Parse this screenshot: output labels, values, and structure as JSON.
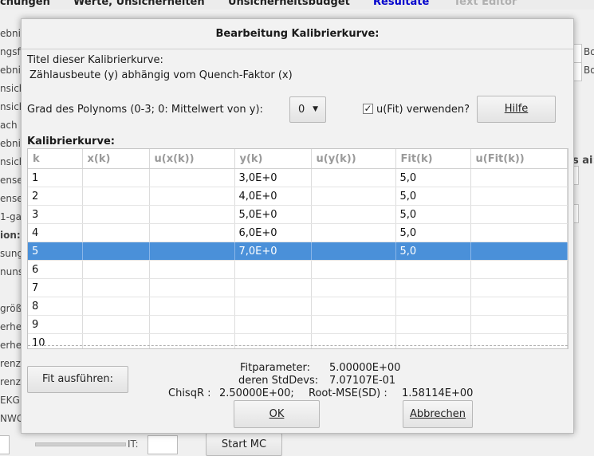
{
  "background": {
    "tabs": [
      "chungen",
      "Werte, Unsicherheiten",
      "Unsicherheitsbudget",
      "Resultate",
      "Text Editor"
    ],
    "tab_colors": {
      "active": "#0000cc",
      "disabled": "#b0b0b0"
    },
    "left_items": [
      "ebnis",
      "ngsfä",
      "ebnis",
      "nsich",
      "nsich",
      "ach",
      "ebnis",
      "nsich",
      "ense",
      "ense",
      "1-ga",
      "ion:",
      "sung",
      "nuns:",
      "",
      "größe",
      "erhei",
      "erhei",
      "renze",
      "renze",
      "EKG",
      "NWG"
    ],
    "right_labels": [
      "Bo",
      "Bo",
      "s ai:"
    ],
    "it_label": "IT:",
    "start_mc_label": "Start MC"
  },
  "dialog": {
    "title": "Bearbeitung Kalibrierkurve:",
    "curve_title_label": "Titel dieser Kalibrierkurve:",
    "curve_title_value": "Zählausbeute (y) abhängig vom Quench-Faktor (x)",
    "polynom_label": "Grad des Polynoms (0-3; 0: Mittelwert von y):",
    "polynom_value": "0",
    "ufit_label": "u(Fit) verwenden?",
    "ufit_checked": true,
    "help_button": "Hilfe",
    "table_label": "Kalibrierkurve:",
    "columns": [
      "k",
      "x(k)",
      "u(x(k))",
      "y(k)",
      "u(y(k))",
      "Fit(k)",
      "u(Fit(k))"
    ],
    "rows": [
      [
        "1",
        "",
        "",
        "3,0E+0",
        "",
        "5,0",
        ""
      ],
      [
        "2",
        "",
        "",
        "4,0E+0",
        "",
        "5,0",
        ""
      ],
      [
        "3",
        "",
        "",
        "5,0E+0",
        "",
        "5,0",
        ""
      ],
      [
        "4",
        "",
        "",
        "6,0E+0",
        "",
        "5,0",
        ""
      ],
      [
        "5",
        "",
        "",
        "7,0E+0",
        "",
        "5,0",
        ""
      ],
      [
        "6",
        "",
        "",
        "",
        "",
        "",
        ""
      ],
      [
        "7",
        "",
        "",
        "",
        "",
        "",
        ""
      ],
      [
        "8",
        "",
        "",
        "",
        "",
        "",
        ""
      ],
      [
        "9",
        "",
        "",
        "",
        "",
        "",
        ""
      ],
      [
        "10",
        "",
        "",
        "",
        "",
        "",
        ""
      ]
    ],
    "selected_row": 5,
    "selection_color": "#4a90d9",
    "fit_button": "Fit ausführen:",
    "fitparam_label": "Fitparameter:",
    "fitparam_value": "5.00000E+00",
    "stddev_label": "deren StdDevs:",
    "stddev_value": "7.07107E-01",
    "chisqr_label": "ChisqR :",
    "chisqr_value": "2.50000E+00;",
    "rmse_label": "Root-MSE(SD) :",
    "rmse_value": "1.58114E+00",
    "ok_button": "OK",
    "cancel_button": "Abbrechen"
  }
}
